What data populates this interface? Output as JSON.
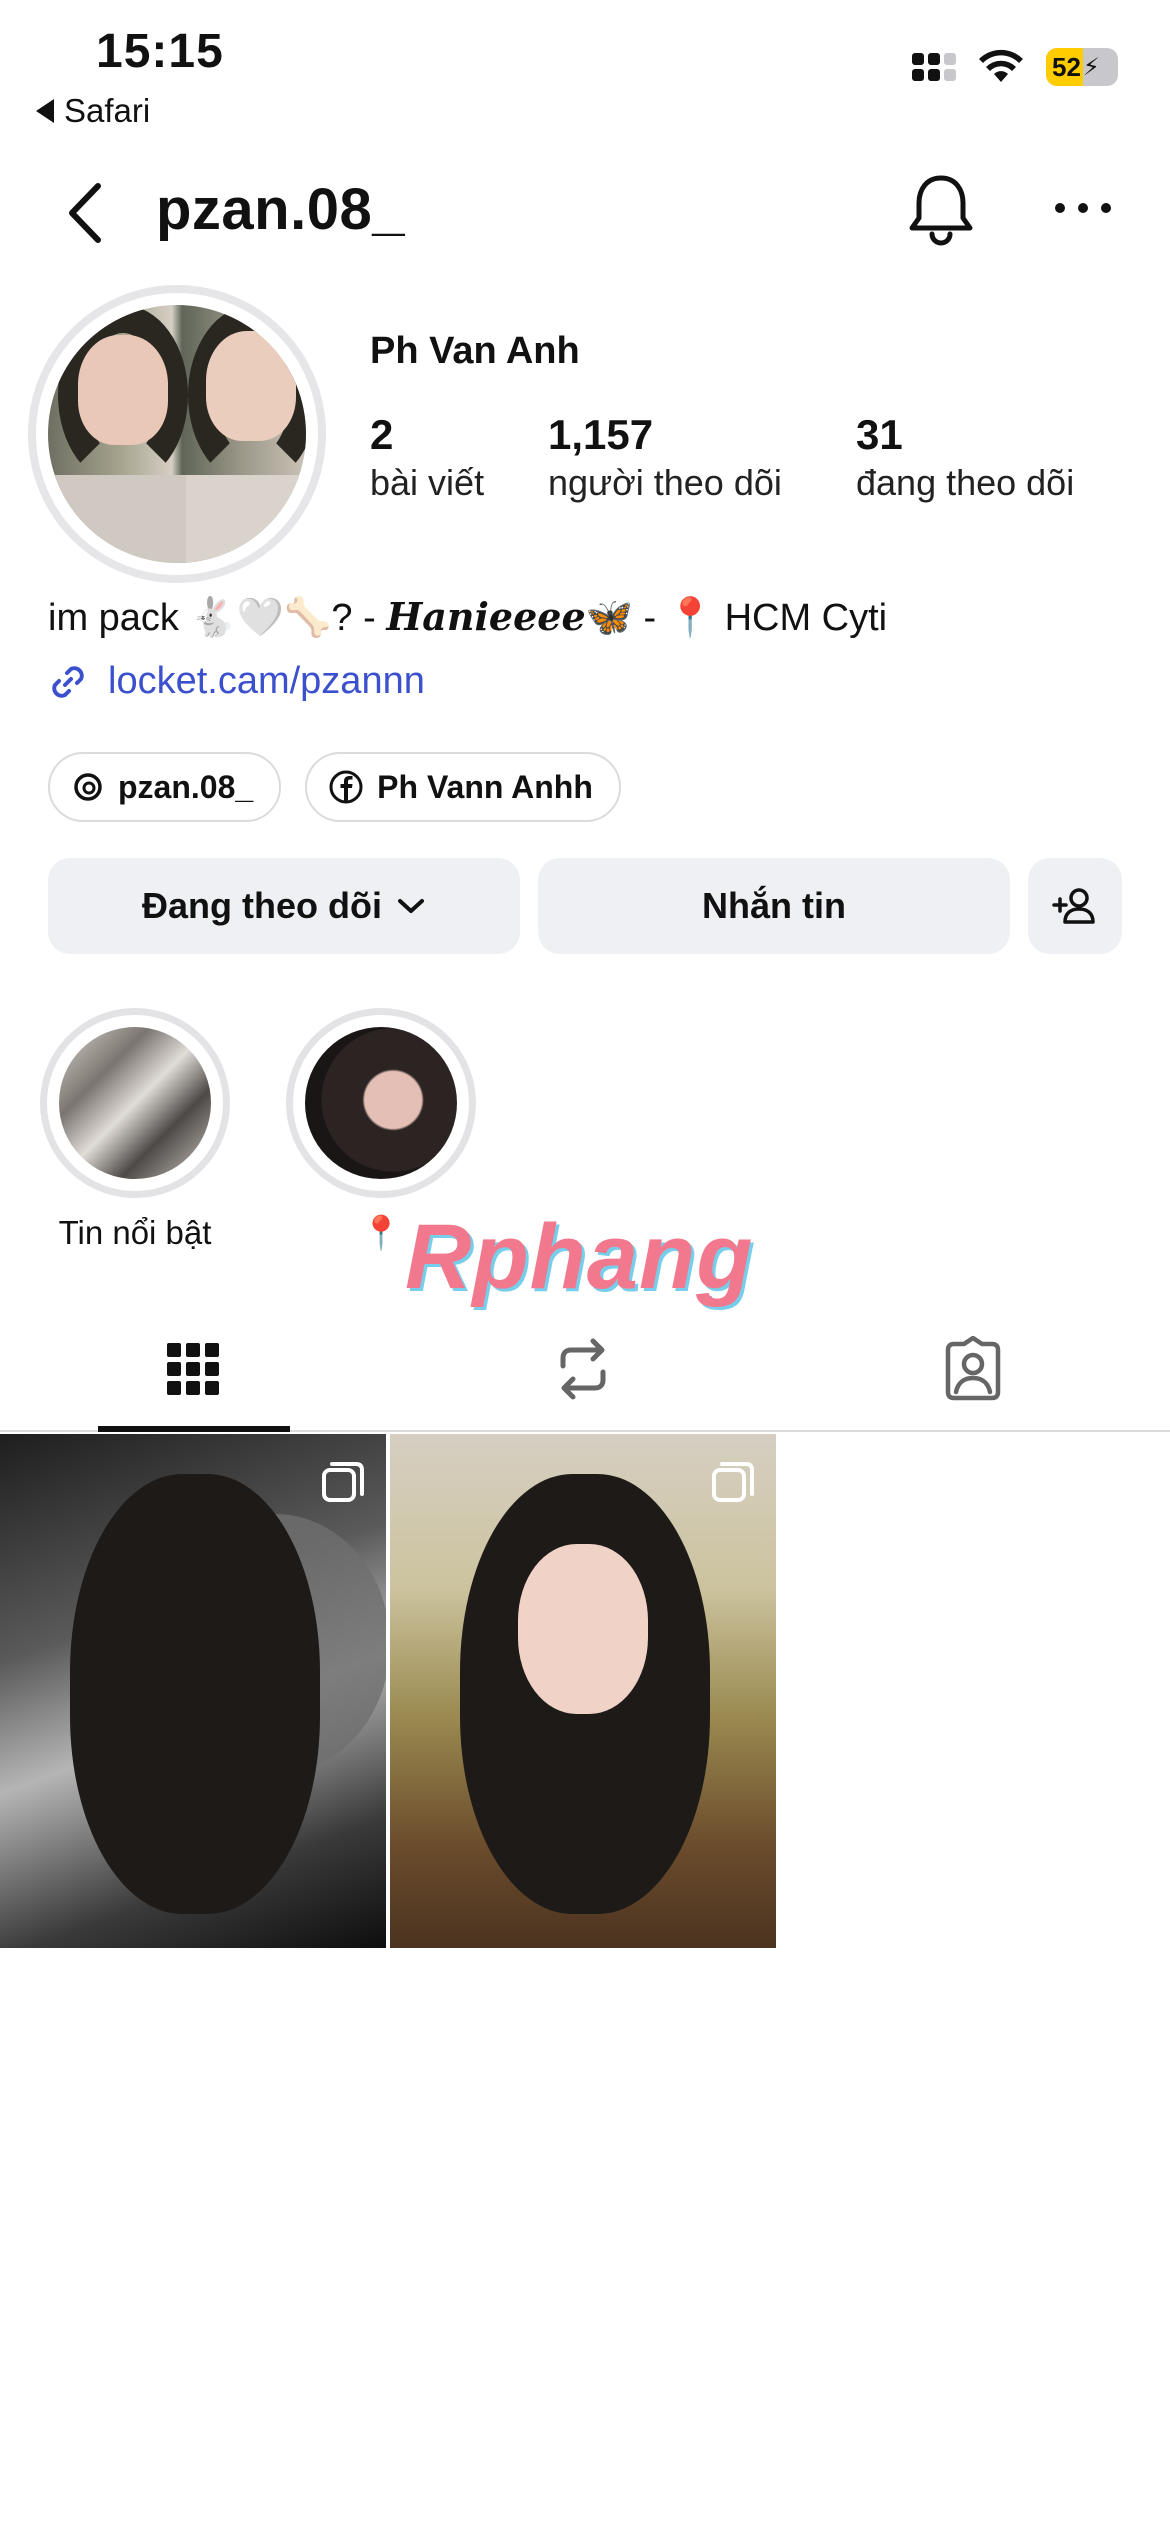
{
  "status_bar": {
    "time": "15:15",
    "back_app": "Safari",
    "battery": "52",
    "battery_level": 0.52,
    "battery_color": "#ffcc00"
  },
  "header": {
    "username": "pzan.08_",
    "icons": [
      "chevron-left-icon",
      "bell-icon",
      "more-icon"
    ]
  },
  "profile": {
    "full_name": "Ph Van Anh",
    "stats": [
      {
        "value": "2",
        "label": "bài viết"
      },
      {
        "value": "1,157",
        "label": "người theo dõi"
      },
      {
        "value": "31",
        "label": "đang theo dõi"
      }
    ],
    "bio_prefix": "im pack 🐇🤍🦴? - ",
    "bio_name": "Hanieeee",
    "bio_suffix": "🦋 - 📍 HCM Cyti",
    "link": "locket.cam/pzannn",
    "link_color": "#3b50cc"
  },
  "chips": [
    {
      "label": "pzan.08_",
      "icon": "threads-icon"
    },
    {
      "label": "Ph Vann Anhh",
      "icon": "facebook-icon"
    }
  ],
  "actions": {
    "following": "Đang theo dõi",
    "message": "Nhắn tin"
  },
  "highlights": [
    {
      "label": "Tin nổi bật"
    },
    {
      "label": "📍"
    }
  ],
  "watermark": "Rphang",
  "tabs": [
    "grid-icon",
    "reposts-icon",
    "tagged-icon"
  ]
}
